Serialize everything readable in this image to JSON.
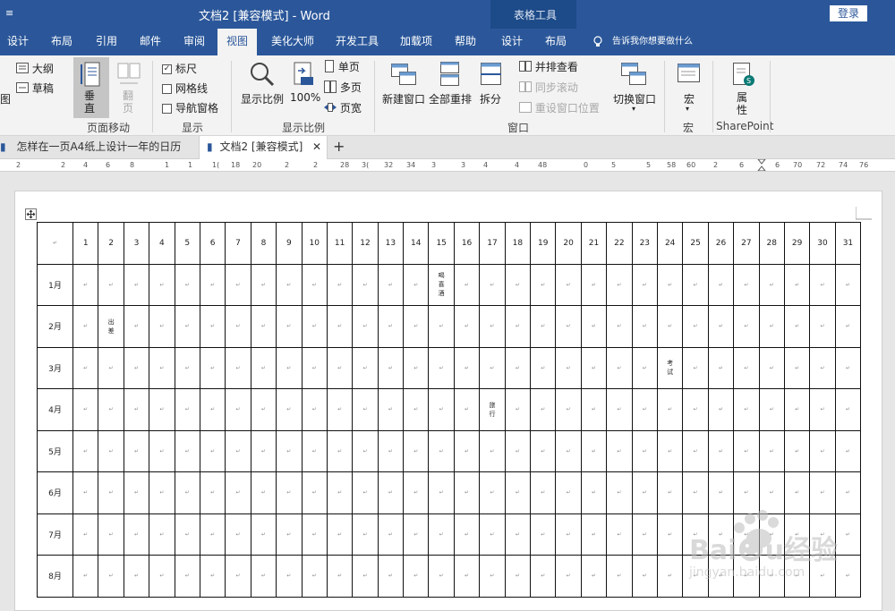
{
  "titlebar": {
    "quick_access": "≡",
    "title": "文档2 [兼容模式]  -  Word",
    "context_tools": "表格工具",
    "login": "登录"
  },
  "tabs": [
    "设计",
    "布局",
    "引用",
    "邮件",
    "审阅",
    "视图",
    "美化大师",
    "开发工具",
    "加载项",
    "帮助",
    "设计",
    "布局",
    "告诉我你想要做什么"
  ],
  "ribbon": {
    "views": {
      "outline": "大纲",
      "draft": "草稿",
      "left_cut": "图"
    },
    "page_move": {
      "vertical": "垂\n直",
      "flip": "翻\n页",
      "label": "页面移动"
    },
    "show": {
      "ruler": "标尺",
      "gridlines": "网格线",
      "nav_pane": "导航窗格",
      "label": "显示"
    },
    "zoom": {
      "zoom": "显示比例",
      "percent": "100%",
      "one_page": "单页",
      "multi_page": "多页",
      "page_width": "页宽",
      "label": "显示比例"
    },
    "window": {
      "new_window": "新建窗口",
      "arrange_all": "全部重排",
      "split": "拆分",
      "side_by_side": "并排查看",
      "sync_scroll": "同步滚动",
      "reset_pos": "重设窗口位置",
      "switch": "切换窗口",
      "label": "窗口"
    },
    "macro": {
      "macro": "宏",
      "label": "宏"
    },
    "sharepoint": {
      "props": "属\n性",
      "label": "SharePoint"
    }
  },
  "doc_tabs": [
    "怎样在一页A4纸上设计一年的日历",
    "文档2 [兼容模式]"
  ],
  "doc_tab_close": "✕",
  "doc_tab_add": "+",
  "ruler_marks": [
    "2",
    "2",
    "4",
    "6",
    "8",
    "1",
    "1",
    "1(",
    "18",
    "20",
    "2",
    "2",
    "28",
    "3(",
    "32",
    "34",
    "3",
    "3",
    "4",
    "4",
    "48",
    "0",
    "5",
    "5",
    "58",
    "60",
    "2",
    "6",
    "6",
    "70",
    "72",
    "74",
    "76"
  ],
  "calendar": {
    "corner": "↵",
    "days": [
      "1",
      "2",
      "3",
      "4",
      "5",
      "6",
      "7",
      "8",
      "9",
      "10",
      "11",
      "12",
      "13",
      "14",
      "15",
      "16",
      "17",
      "18",
      "19",
      "20",
      "21",
      "22",
      "23",
      "24",
      "25",
      "26",
      "27",
      "28",
      "29",
      "30",
      "31"
    ],
    "months": [
      "1月",
      "2月",
      "3月",
      "4月",
      "5月",
      "6月",
      "7月",
      "8月"
    ],
    "cell_mark": "↵",
    "notes": [
      {
        "month": 1,
        "day": 15,
        "text": "喝\n喜\n酒"
      },
      {
        "month": 2,
        "day": 2,
        "text": "出\n差"
      },
      {
        "month": 3,
        "day": 24,
        "text": "考\n试"
      },
      {
        "month": 4,
        "day": 17,
        "text": "旅\n行"
      }
    ]
  },
  "watermark": {
    "brand": "Bai☻u经验",
    "url": "jingyan.baidu.com"
  }
}
